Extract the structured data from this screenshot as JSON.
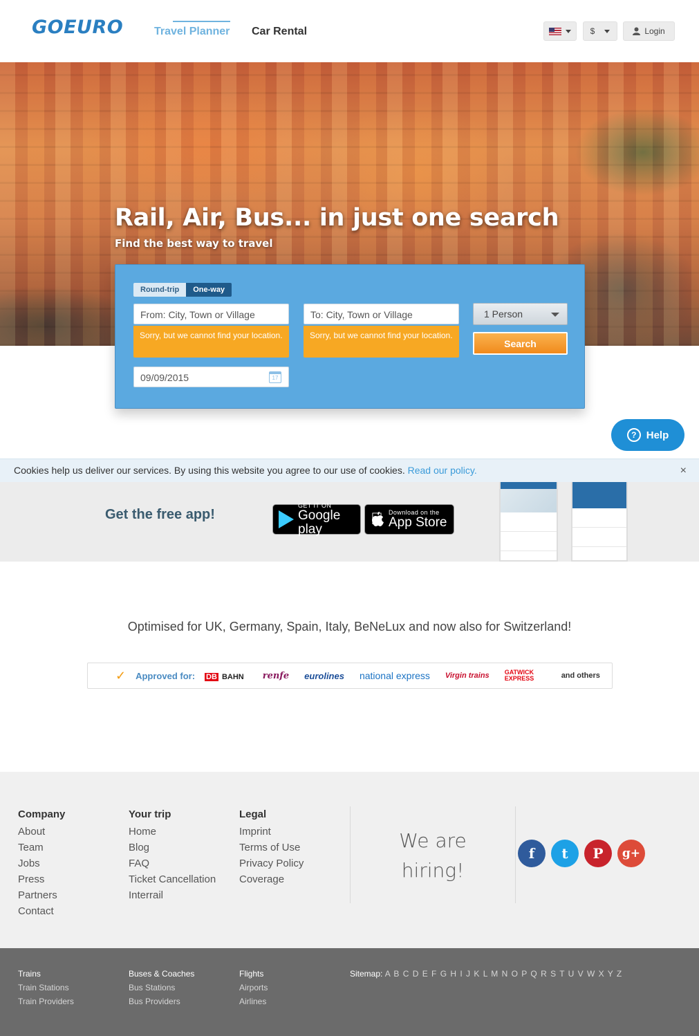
{
  "header": {
    "logo": "GOEURO",
    "nav": {
      "planner": "Travel Planner",
      "car": "Car Rental"
    },
    "currency": "$",
    "login": "Login"
  },
  "hero": {
    "title": "Rail, Air, Bus... in just one search",
    "subtitle": "Find the best way to travel"
  },
  "search": {
    "trip_round": "Round-trip",
    "trip_oneway": "One-way",
    "from_placeholder": "From: City, Town or Village",
    "to_placeholder": "To: City, Town or Village",
    "from_error": "Sorry, but we cannot find your location.",
    "to_error": "Sorry, but we cannot find your location.",
    "date": "09/09/2015",
    "calendar_day": "17",
    "persons": "1 Person",
    "button": "Search"
  },
  "help": "Help",
  "cookie": {
    "text": "Cookies help us deliver our services. By using this website you agree to our use of cookies. ",
    "link": "Read our policy.",
    "close": "×"
  },
  "app": {
    "title": "Get the free app!",
    "google_small": "GET IT ON",
    "google_big": "Google play",
    "apple_small": "Download on the",
    "apple_big": "App Store"
  },
  "optimised": "Optimised for UK, Germany, Spain, Italy, BeNeLux and now also for Switzerland!",
  "approved": {
    "label": "Approved for:",
    "partners": [
      "DB",
      "BAHN",
      "renfe",
      "eurolines",
      "national express",
      "Virgin trains",
      "GATWICK EXPRESS"
    ],
    "others": "and others"
  },
  "footer": {
    "company": {
      "title": "Company",
      "links": [
        "About",
        "Team",
        "Jobs",
        "Press",
        "Partners",
        "Contact"
      ]
    },
    "trip": {
      "title": "Your trip",
      "links": [
        "Home",
        "Blog",
        "FAQ",
        "Ticket Cancellation",
        "Interrail"
      ]
    },
    "legal": {
      "title": "Legal",
      "links": [
        "Imprint",
        "Terms of Use",
        "Privacy Policy",
        "Coverage"
      ]
    },
    "hiring": "We are hiring!",
    "social": [
      "f",
      "t",
      "P",
      "g+"
    ]
  },
  "footer2": {
    "trains": {
      "title": "Trains",
      "links": [
        "Train Stations",
        "Train Providers"
      ]
    },
    "buses": {
      "title": "Buses & Coaches",
      "links": [
        "Bus Stations",
        "Bus Providers"
      ]
    },
    "flights": {
      "title": "Flights",
      "links": [
        "Airports",
        "Airlines"
      ]
    },
    "sitemap_label": "Sitemap:",
    "sitemap_letters": "A B C D E F G H I J K L M N O P Q R S T U V W X Y Z"
  },
  "colors": {
    "accent": "#5ba9e0",
    "brand": "#2a7fc1",
    "warning": "#f7a823",
    "cta": "#f08a1c"
  }
}
